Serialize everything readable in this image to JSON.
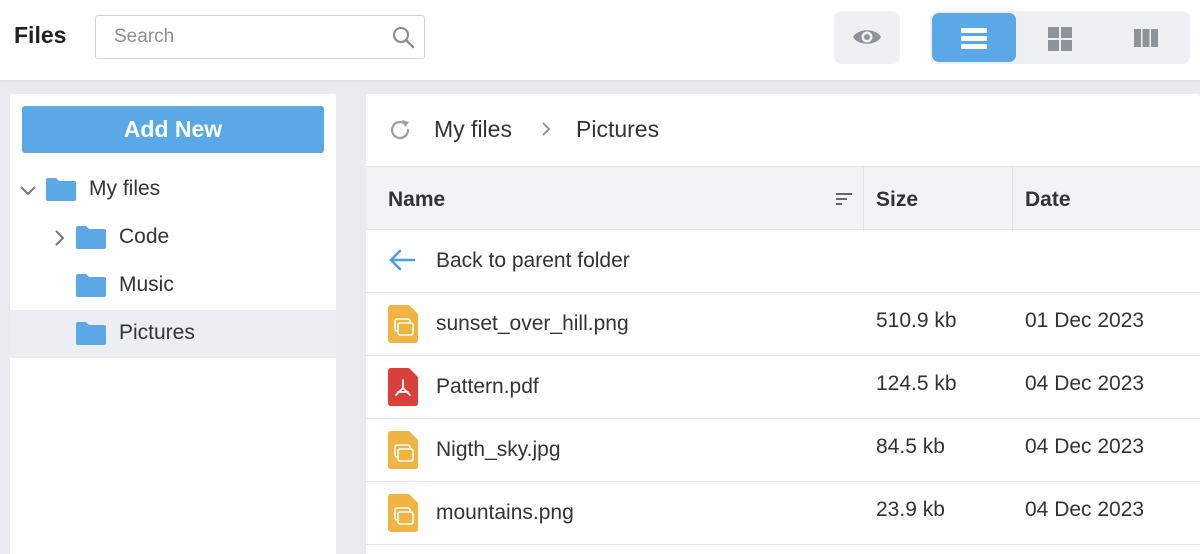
{
  "app": {
    "title": "Files"
  },
  "search": {
    "placeholder": "Search",
    "icon": "search-icon"
  },
  "toolbar": {
    "preview_icon": "eye-icon",
    "views": [
      {
        "name": "list-view",
        "icon": "list-icon",
        "active": true
      },
      {
        "name": "tiles-view",
        "icon": "grid-icon",
        "active": false
      },
      {
        "name": "columns-view",
        "icon": "columns-icon",
        "active": false
      }
    ]
  },
  "sidebar": {
    "add_button": "Add New",
    "tree": [
      {
        "label": "My files",
        "expanded": true,
        "level": 0
      },
      {
        "label": "Code",
        "expanded": false,
        "level": 1
      },
      {
        "label": "Music",
        "level": 1
      },
      {
        "label": "Pictures",
        "level": 1,
        "selected": true
      }
    ]
  },
  "breadcrumb": {
    "items": [
      "My files",
      "Pictures"
    ]
  },
  "table": {
    "columns": {
      "name": "Name",
      "size": "Size",
      "date": "Date"
    },
    "back_row": "Back to parent folder",
    "rows": [
      {
        "name": "sunset_over_hill.png",
        "size": "510.9 kb",
        "date": "01 Dec 2023",
        "type": "image"
      },
      {
        "name": "Pattern.pdf",
        "size": "124.5 kb",
        "date": "04 Dec 2023",
        "type": "pdf"
      },
      {
        "name": "Nigth_sky.jpg",
        "size": "84.5 kb",
        "date": "04 Dec 2023",
        "type": "image"
      },
      {
        "name": "mountains.png",
        "size": "23.9 kb",
        "date": "04 Dec 2023",
        "type": "image"
      }
    ]
  },
  "colors": {
    "accent": "#5aa8e6",
    "folder": "#5aa8e6",
    "image_file": "#f0b443",
    "pdf_file": "#d9403a"
  }
}
